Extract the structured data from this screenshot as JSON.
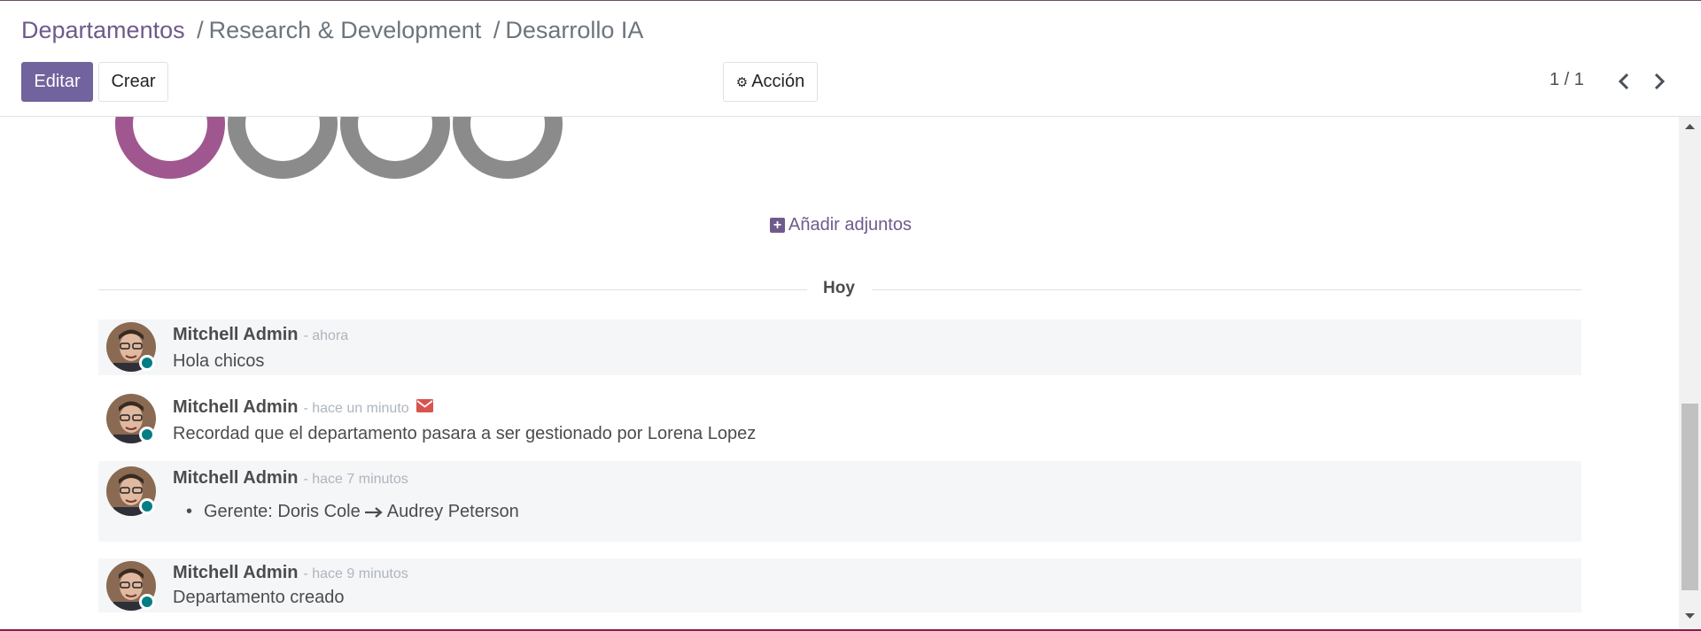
{
  "breadcrumb": {
    "root": "Departamentos",
    "parent": "Research & Development",
    "current": "Desarrollo IA",
    "separator": "/"
  },
  "toolbar": {
    "edit_label": "Editar",
    "create_label": "Crear",
    "action_label": "Acción",
    "action_icon": "gear-icon"
  },
  "pager": {
    "value": "1 / 1",
    "prev_icon": "chevron-left-icon",
    "next_icon": "chevron-right-icon"
  },
  "attachments": {
    "add_label": "Añadir adjuntos",
    "icon": "plus-square-icon"
  },
  "chatter": {
    "day_label": "Hoy",
    "messages": [
      {
        "author": "Mitchell Admin",
        "time": "- ahora",
        "body": "Hola chicos"
      },
      {
        "author": "Mitchell Admin",
        "time": "- hace un minuto",
        "body": "Recordad que el departamento pasara a ser gestionado por Lorena Lopez",
        "icon": "envelope-icon"
      },
      {
        "author": "Mitchell Admin",
        "time": "- hace 7 minutos",
        "tracking": {
          "field": "Gerente:",
          "old": "Doris Cole",
          "new": "Audrey Peterson"
        }
      },
      {
        "author": "Mitchell Admin",
        "time": "- hace 9 minutos",
        "body": "Departamento creado"
      }
    ]
  },
  "colors": {
    "primary": "#71639e",
    "link": "#6f5a8c",
    "presence": "#017e84",
    "envelope": "#d9534f",
    "ring_active": "#a0578f",
    "ring_inactive": "#8b8b8b"
  }
}
